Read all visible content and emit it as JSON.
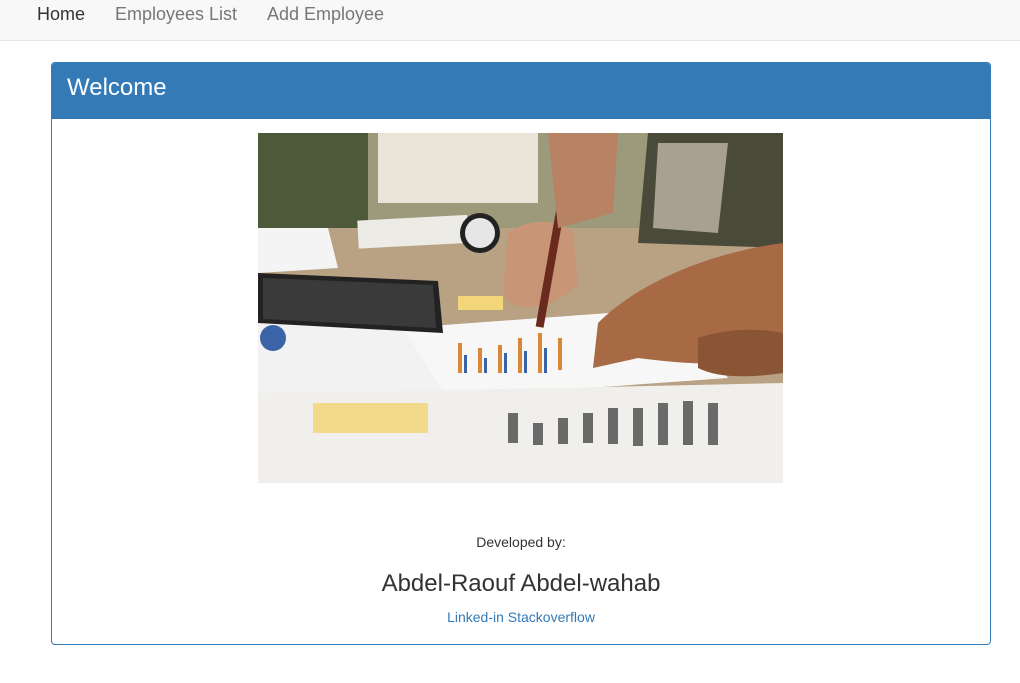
{
  "navbar": {
    "items": [
      {
        "label": "Home",
        "active": true
      },
      {
        "label": "Employees List",
        "active": false
      },
      {
        "label": "Add Employee",
        "active": false
      }
    ]
  },
  "panel": {
    "title": "Welcome",
    "image_subject": "business-charts-photo",
    "developed_by_label": "Developed by:",
    "developer_name": "Abdel-Raouf Abdel-wahab",
    "links": {
      "linkedin": "Linked-in",
      "stackoverflow": "Stackoverflow"
    }
  },
  "colors": {
    "primary": "#337ab7",
    "navbar_bg": "#f8f8f8",
    "nav_active": "#333333",
    "nav_inactive": "#777777"
  }
}
